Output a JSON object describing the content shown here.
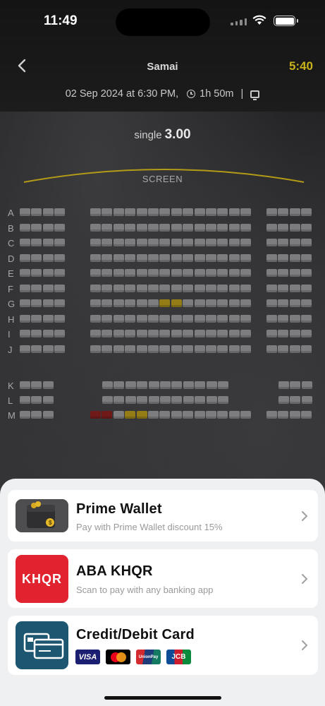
{
  "status_bar": {
    "time": "11:49"
  },
  "header": {
    "title": "Samai",
    "countdown": "5:40",
    "showtime": "02 Sep 2024 at 6:30 PM,",
    "duration": "1h 50m",
    "separator": "|"
  },
  "pricing": {
    "type_label": "single",
    "amount": "3.00"
  },
  "screen_label": "SCREEN",
  "rows": [
    "A",
    "B",
    "C",
    "D",
    "E",
    "F",
    "G",
    "H",
    "I",
    "J",
    "K",
    "L",
    "M"
  ],
  "payment_methods": [
    {
      "name": "Prime Wallet",
      "description": "Pay with Prime Wallet discount 15%",
      "icon": "wallet-icon"
    },
    {
      "name": "ABA KHQR",
      "description": "Scan to pay with any banking app",
      "icon": "khqr-icon",
      "logo_text": "KHQR"
    },
    {
      "name": "Credit/Debit Card",
      "icon": "card-icon",
      "card_brands": [
        "VISA",
        "Mastercard",
        "UnionPay",
        "JCB"
      ]
    }
  ],
  "colors": {
    "accent": "#c8b21a",
    "selected_seat": "#a58a12",
    "sold_seat": "#7a1414",
    "khqr_red": "#e1232f",
    "card_teal": "#1c5670"
  }
}
